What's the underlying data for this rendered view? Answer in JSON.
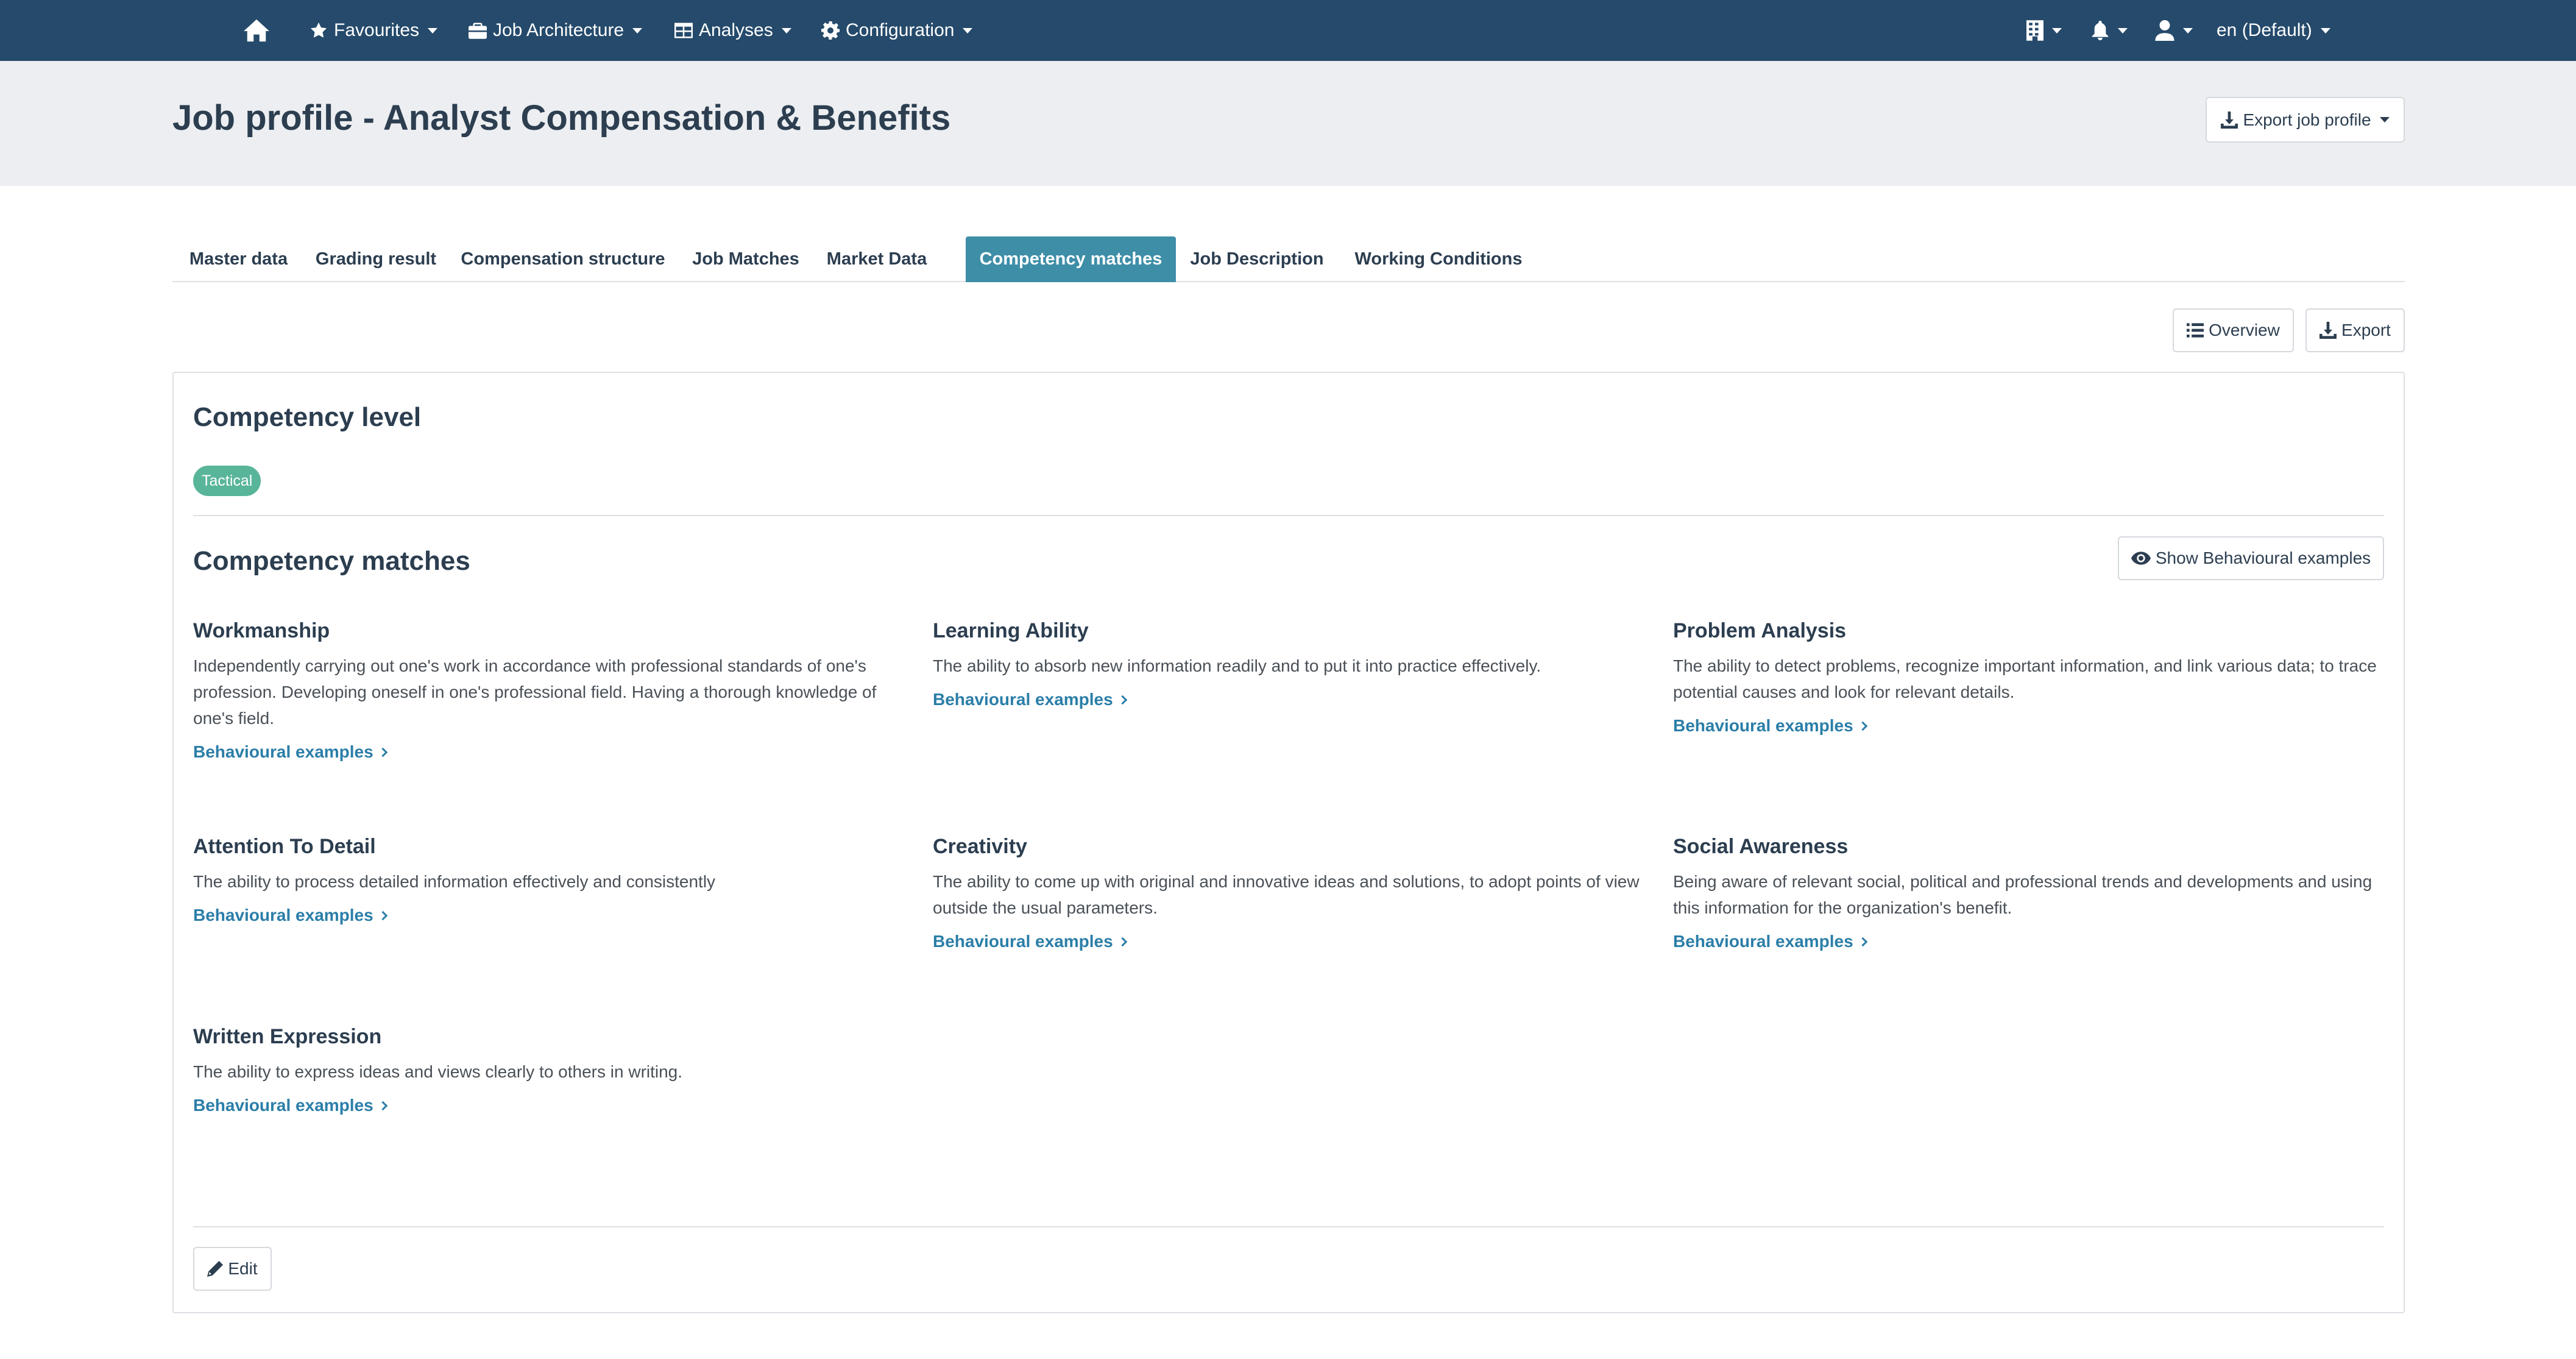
{
  "nav": {
    "favourites": "Favourites",
    "job_architecture": "Job Architecture",
    "analyses": "Analyses",
    "configuration": "Configuration",
    "language": "en (Default)"
  },
  "page": {
    "title": "Job profile - Analyst Compensation & Benefits",
    "export_profile": "Export job profile"
  },
  "tabs": [
    {
      "label": "Master data"
    },
    {
      "label": "Grading result"
    },
    {
      "label": "Compensation structure"
    },
    {
      "label": "Job Matches"
    },
    {
      "label": "Market Data"
    },
    {
      "label": "Competency matches"
    },
    {
      "label": "Job Description"
    },
    {
      "label": "Working Conditions"
    }
  ],
  "toolbar": {
    "overview": "Overview",
    "export": "Export"
  },
  "competency_level": {
    "heading": "Competency level",
    "badge": "Tactical"
  },
  "competency_matches": {
    "heading": "Competency matches",
    "show_examples": "Show Behavioural examples",
    "items": [
      {
        "title": "Workmanship",
        "description": "Independently carrying out one's work in accordance with professional standards of one's profession. Developing oneself in one's professional field. Having a thorough knowledge of one's field.",
        "link": "Behavioural examples"
      },
      {
        "title": "Learning Ability",
        "description": "The ability to absorb new information readily and to put it into practice effectively.",
        "link": "Behavioural examples"
      },
      {
        "title": "Problem Analysis",
        "description": "The ability to detect problems, recognize important information, and link various data; to trace potential causes and look for relevant details.",
        "link": "Behavioural examples"
      },
      {
        "title": "Attention To Detail",
        "description": "The ability to process detailed information effectively and consistently",
        "link": "Behavioural examples"
      },
      {
        "title": "Creativity",
        "description": "The ability to come up with original and innovative ideas and solutions, to adopt points of view outside the usual parameters.",
        "link": "Behavioural examples"
      },
      {
        "title": "Social Awareness",
        "description": "Being aware of relevant social, political and professional trends and developments and using this information for the organization's benefit.",
        "link": "Behavioural examples"
      },
      {
        "title": "Written Expression",
        "description": "The ability to express ideas and views clearly to others in writing.",
        "link": "Behavioural examples"
      }
    ]
  },
  "edit_label": "Edit"
}
